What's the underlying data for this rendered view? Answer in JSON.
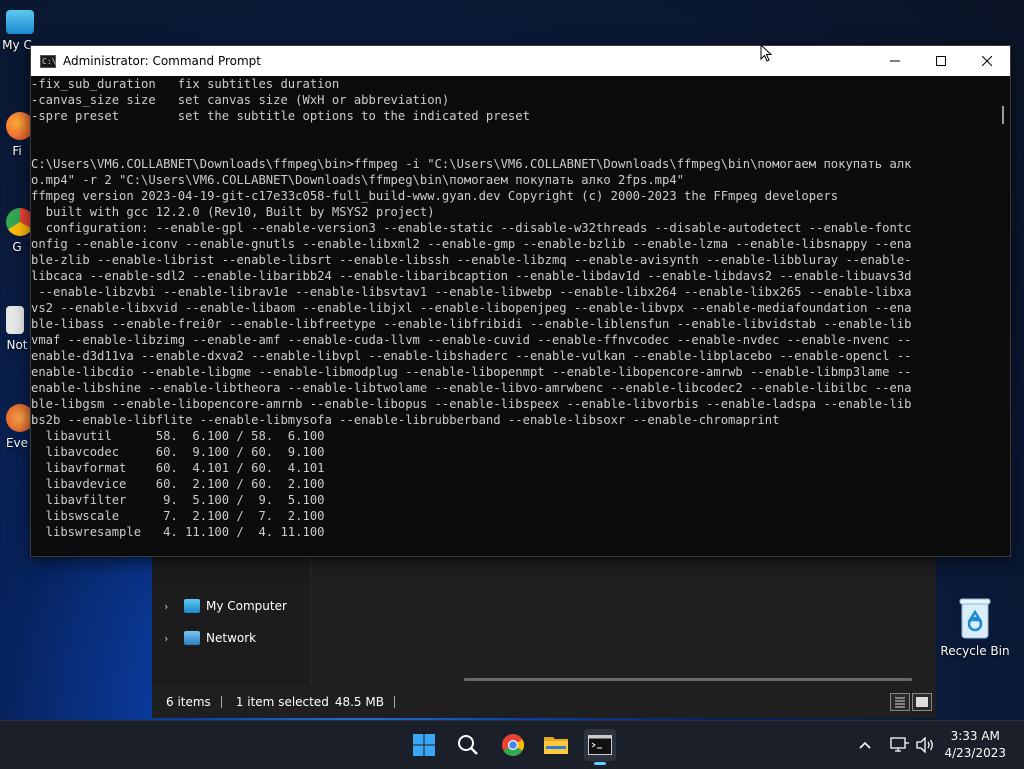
{
  "desktop": {
    "left_icons": [
      {
        "label": "My C",
        "icon": "monitor-icon"
      },
      {
        "label": "Fi",
        "icon": "firefox-icon"
      },
      {
        "label": "G",
        "icon": "chrome-icon"
      },
      {
        "label": "Not",
        "icon": "notepad-icon"
      },
      {
        "label": "Eve",
        "icon": "app-icon"
      }
    ],
    "recycle_bin": {
      "label": "Recycle Bin",
      "icon": "recycle-bin-icon"
    }
  },
  "explorer": {
    "nav_items": [
      {
        "label": "My Computer",
        "icon": "computer-icon"
      },
      {
        "label": "Network",
        "icon": "network-icon"
      }
    ],
    "status": {
      "items_count": "6 items",
      "selected": "1 item selected",
      "size": "48.5 MB"
    }
  },
  "cmd": {
    "title": "Administrator: Command Prompt",
    "lines": [
      "-fix_sub_duration   fix subtitles duration",
      "-canvas_size size   set canvas size (WxH or abbreviation)",
      "-spre preset        set the subtitle options to the indicated preset",
      "",
      "",
      "C:\\Users\\VM6.COLLABNET\\Downloads\\ffmpeg\\bin>ffmpeg -i \"C:\\Users\\VM6.COLLABNET\\Downloads\\ffmpeg\\bin\\помогаем покупать алк",
      "o.mp4\" -r 2 \"C:\\Users\\VM6.COLLABNET\\Downloads\\ffmpeg\\bin\\помогаем покупать алко 2fps.mp4\"",
      "ffmpeg version 2023-04-19-git-c17e33c058-full_build-www.gyan.dev Copyright (c) 2000-2023 the FFmpeg developers",
      "  built with gcc 12.2.0 (Rev10, Built by MSYS2 project)",
      "  configuration: --enable-gpl --enable-version3 --enable-static --disable-w32threads --disable-autodetect --enable-fontc",
      "onfig --enable-iconv --enable-gnutls --enable-libxml2 --enable-gmp --enable-bzlib --enable-lzma --enable-libsnappy --ena",
      "ble-zlib --enable-librist --enable-libsrt --enable-libssh --enable-libzmq --enable-avisynth --enable-libbluray --enable-",
      "libcaca --enable-sdl2 --enable-libaribb24 --enable-libaribcaption --enable-libdav1d --enable-libdavs2 --enable-libuavs3d",
      " --enable-libzvbi --enable-librav1e --enable-libsvtav1 --enable-libwebp --enable-libx264 --enable-libx265 --enable-libxa",
      "vs2 --enable-libxvid --enable-libaom --enable-libjxl --enable-libopenjpeg --enable-libvpx --enable-mediafoundation --ena",
      "ble-libass --enable-frei0r --enable-libfreetype --enable-libfribidi --enable-liblensfun --enable-libvidstab --enable-lib",
      "vmaf --enable-libzimg --enable-amf --enable-cuda-llvm --enable-cuvid --enable-ffnvcodec --enable-nvdec --enable-nvenc --",
      "enable-d3d11va --enable-dxva2 --enable-libvpl --enable-libshaderc --enable-vulkan --enable-libplacebo --enable-opencl --",
      "enable-libcdio --enable-libgme --enable-libmodplug --enable-libopenmpt --enable-libopencore-amrwb --enable-libmp3lame --",
      "enable-libshine --enable-libtheora --enable-libtwolame --enable-libvo-amrwbenc --enable-libcodec2 --enable-libilbc --ena",
      "ble-libgsm --enable-libopencore-amrnb --enable-libopus --enable-libspeex --enable-libvorbis --enable-ladspa --enable-lib",
      "bs2b --enable-libflite --enable-libmysofa --enable-librubberband --enable-libsoxr --enable-chromaprint",
      "  libavutil      58.  6.100 / 58.  6.100",
      "  libavcodec     60.  9.100 / 60.  9.100",
      "  libavformat    60.  4.101 / 60.  4.101",
      "  libavdevice    60.  2.100 / 60.  2.100",
      "  libavfilter     9.  5.100 /  9.  5.100",
      "  libswscale      7.  2.100 /  7.  2.100",
      "  libswresample   4. 11.100 /  4. 11.100"
    ]
  },
  "taskbar": {
    "apps": [
      {
        "name": "Start",
        "icon": "windows-start-icon"
      },
      {
        "name": "Search",
        "icon": "search-icon"
      },
      {
        "name": "Chrome",
        "icon": "chrome-icon"
      },
      {
        "name": "File Explorer",
        "icon": "folder-icon"
      },
      {
        "name": "Command Prompt",
        "icon": "terminal-icon",
        "active": true
      }
    ],
    "clock": {
      "time": "3:33 AM",
      "date": "4/23/2023"
    }
  },
  "colors": {
    "console_bg": "#0c0c0c",
    "console_text": "#cccccc",
    "taskbar_bg": "#1b1f2a"
  }
}
